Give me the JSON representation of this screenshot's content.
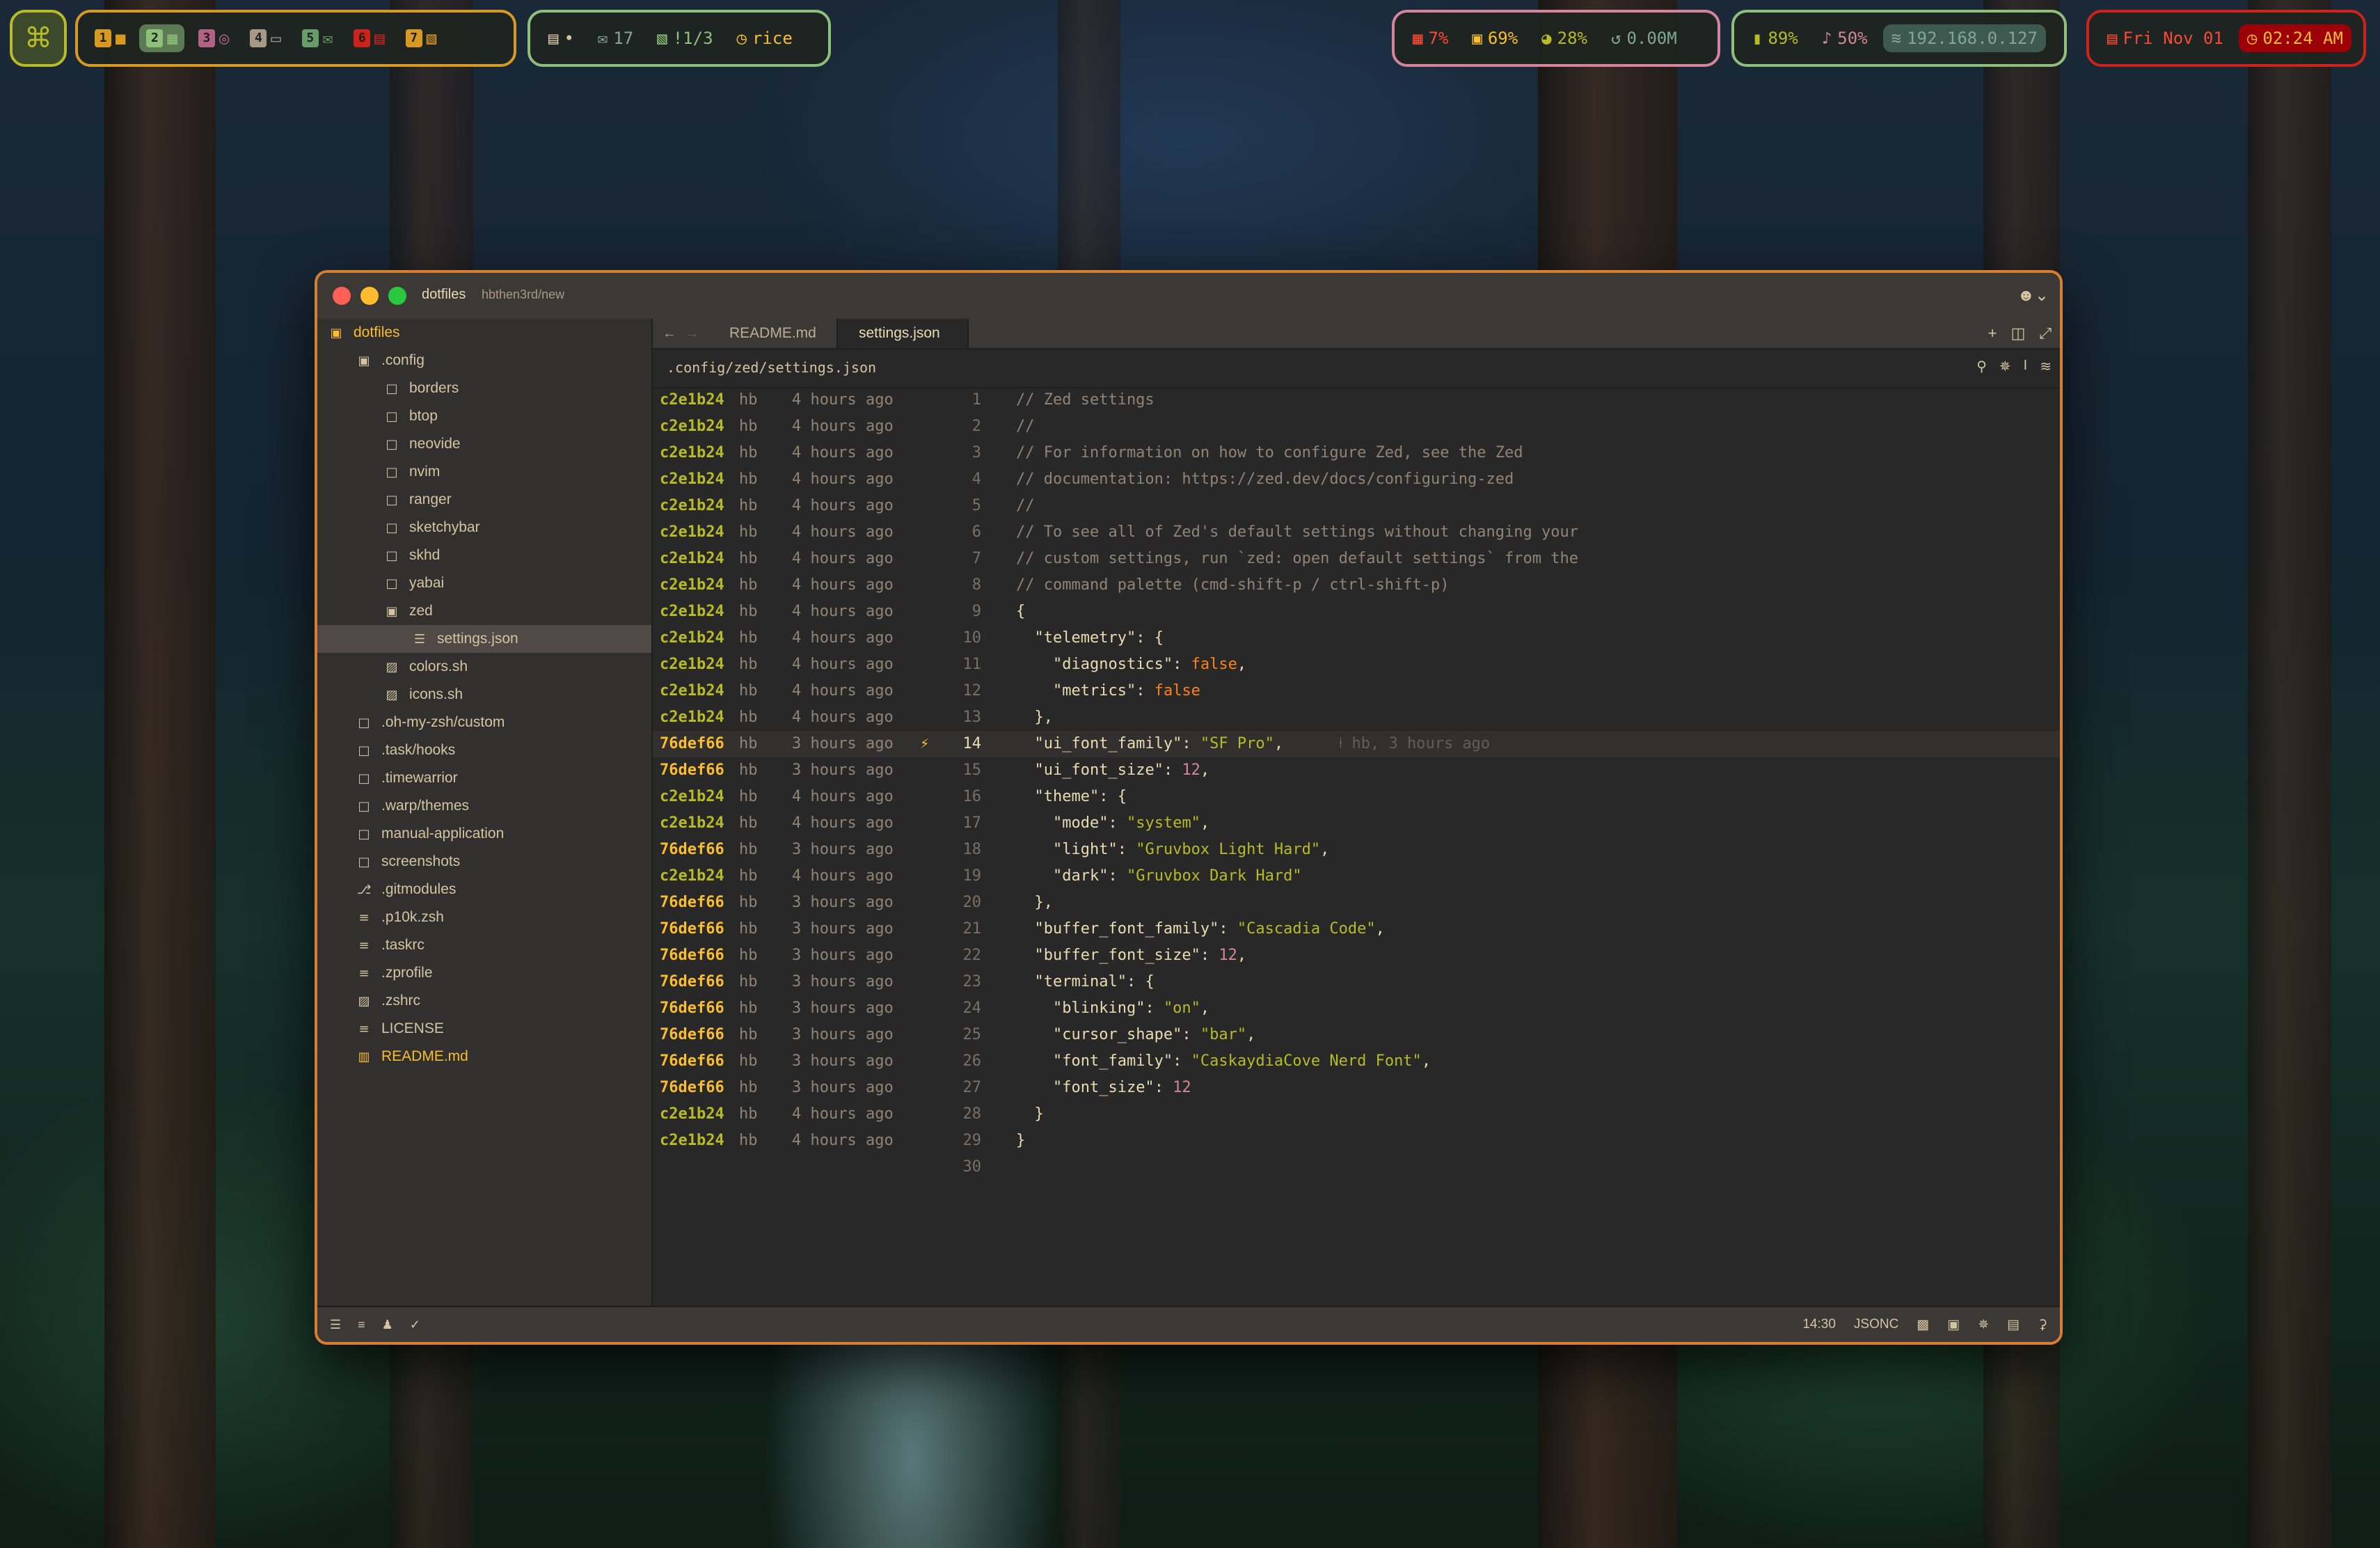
{
  "topbar": {
    "workspaces": [
      {
        "num": "1",
        "icon": "■",
        "color": "#d79921",
        "active": false
      },
      {
        "num": "2",
        "icon": "▦",
        "color": "#8ec07c",
        "active": true
      },
      {
        "num": "3",
        "icon": "◎",
        "color": "#b16286",
        "active": false
      },
      {
        "num": "4",
        "icon": "▭",
        "color": "#a89984",
        "active": false
      },
      {
        "num": "5",
        "icon": "✉",
        "color": "#689d6a",
        "active": false
      },
      {
        "num": "6",
        "icon": "▤",
        "color": "#cc241d",
        "active": false
      },
      {
        "num": "7",
        "icon": "▧",
        "color": "#d79921",
        "active": false
      }
    ],
    "messages_dot": "•",
    "mail_count": "17",
    "tasks": "!1/3",
    "mode": "rice",
    "cpu": "7%",
    "memory": "69%",
    "disk": "28%",
    "network": "0.00M",
    "battery": "89%",
    "volume": "50%",
    "ip": "192.168.0.127",
    "date": "Fri Nov 01",
    "time": "02:24 AM"
  },
  "window": {
    "title": "dotfiles",
    "branch": "hbthen3rd/new"
  },
  "sidebar": {
    "root": "dotfiles",
    "items": [
      {
        "label": ".config",
        "icon": "folder-open-icon",
        "glyph": "▣",
        "depth": 1,
        "selected": false,
        "color": "#d5c4a1"
      },
      {
        "label": "borders",
        "icon": "folder-icon",
        "glyph": "□",
        "depth": 2,
        "selected": false,
        "color": "#d5c4a1"
      },
      {
        "label": "btop",
        "icon": "folder-icon",
        "glyph": "□",
        "depth": 2,
        "selected": false,
        "color": "#d5c4a1"
      },
      {
        "label": "neovide",
        "icon": "folder-icon",
        "glyph": "□",
        "depth": 2,
        "selected": false,
        "color": "#d5c4a1"
      },
      {
        "label": "nvim",
        "icon": "folder-icon",
        "glyph": "□",
        "depth": 2,
        "selected": false,
        "color": "#d5c4a1"
      },
      {
        "label": "ranger",
        "icon": "folder-icon",
        "glyph": "□",
        "depth": 2,
        "selected": false,
        "color": "#d5c4a1"
      },
      {
        "label": "sketchybar",
        "icon": "folder-icon",
        "glyph": "□",
        "depth": 2,
        "selected": false,
        "color": "#d5c4a1"
      },
      {
        "label": "skhd",
        "icon": "folder-icon",
        "glyph": "□",
        "depth": 2,
        "selected": false,
        "color": "#d5c4a1"
      },
      {
        "label": "yabai",
        "icon": "folder-icon",
        "glyph": "□",
        "depth": 2,
        "selected": false,
        "color": "#d5c4a1"
      },
      {
        "label": "zed",
        "icon": "folder-open-icon",
        "glyph": "▣",
        "depth": 2,
        "selected": false,
        "color": "#d5c4a1"
      },
      {
        "label": "settings.json",
        "icon": "json-file-icon",
        "glyph": "☰",
        "depth": 3,
        "selected": true,
        "color": "#d5c4a1"
      },
      {
        "label": "colors.sh",
        "icon": "shell-file-icon",
        "glyph": "▨",
        "depth": 2,
        "selected": false,
        "color": "#d5c4a1"
      },
      {
        "label": "icons.sh",
        "icon": "shell-file-icon",
        "glyph": "▨",
        "depth": 2,
        "selected": false,
        "color": "#d5c4a1"
      },
      {
        "label": ".oh-my-zsh/custom",
        "icon": "folder-icon",
        "glyph": "□",
        "depth": 1,
        "selected": false,
        "color": "#d5c4a1"
      },
      {
        "label": ".task/hooks",
        "icon": "folder-icon",
        "glyph": "□",
        "depth": 1,
        "selected": false,
        "color": "#d5c4a1"
      },
      {
        "label": ".timewarrior",
        "icon": "folder-icon",
        "glyph": "□",
        "depth": 1,
        "selected": false,
        "color": "#d5c4a1"
      },
      {
        "label": ".warp/themes",
        "icon": "folder-icon",
        "glyph": "□",
        "depth": 1,
        "selected": false,
        "color": "#d5c4a1"
      },
      {
        "label": "manual-application",
        "icon": "folder-icon",
        "glyph": "□",
        "depth": 1,
        "selected": false,
        "color": "#d5c4a1"
      },
      {
        "label": "screenshots",
        "icon": "folder-icon",
        "glyph": "□",
        "depth": 1,
        "selected": false,
        "color": "#d5c4a1"
      },
      {
        "label": ".gitmodules",
        "icon": "git-icon",
        "glyph": "⎇",
        "depth": 1,
        "selected": false,
        "color": "#d5c4a1"
      },
      {
        "label": ".p10k.zsh",
        "icon": "text-file-icon",
        "glyph": "≡",
        "depth": 1,
        "selected": false,
        "color": "#d5c4a1"
      },
      {
        "label": ".taskrc",
        "icon": "text-file-icon",
        "glyph": "≡",
        "depth": 1,
        "selected": false,
        "color": "#d5c4a1"
      },
      {
        "label": ".zprofile",
        "icon": "text-file-icon",
        "glyph": "≡",
        "depth": 1,
        "selected": false,
        "color": "#d5c4a1"
      },
      {
        "label": ".zshrc",
        "icon": "shell-file-icon",
        "glyph": "▨",
        "depth": 1,
        "selected": false,
        "color": "#d5c4a1"
      },
      {
        "label": "LICENSE",
        "icon": "text-file-icon",
        "glyph": "≡",
        "depth": 1,
        "selected": false,
        "color": "#d5c4a1"
      },
      {
        "label": "README.md",
        "icon": "book-icon",
        "glyph": "▥",
        "depth": 1,
        "selected": false,
        "color": "#fabd2f"
      }
    ]
  },
  "tabs": [
    {
      "label": "README.md",
      "active": false
    },
    {
      "label": "settings.json",
      "active": true
    }
  ],
  "editor": {
    "path": ".config/zed/settings.json",
    "inline_blame": "hb, 3 hours ago",
    "current_line": 14,
    "lines": [
      {
        "hash": "c2e1b24",
        "author": "hb",
        "time": "4 hours ago",
        "n": "1",
        "html": "<span class='c'>// Zed settings</span>"
      },
      {
        "hash": "c2e1b24",
        "author": "hb",
        "time": "4 hours ago",
        "n": "2",
        "html": "<span class='c'>//</span>"
      },
      {
        "hash": "c2e1b24",
        "author": "hb",
        "time": "4 hours ago",
        "n": "3",
        "html": "<span class='c'>// For information on how to configure Zed, see the Zed</span>"
      },
      {
        "hash": "c2e1b24",
        "author": "hb",
        "time": "4 hours ago",
        "n": "4",
        "html": "<span class='c'>// documentation: https://zed.dev/docs/configuring-zed</span>"
      },
      {
        "hash": "c2e1b24",
        "author": "hb",
        "time": "4 hours ago",
        "n": "5",
        "html": "<span class='c'>//</span>"
      },
      {
        "hash": "c2e1b24",
        "author": "hb",
        "time": "4 hours ago",
        "n": "6",
        "html": "<span class='c'>// To see all of Zed's default settings without changing your</span>"
      },
      {
        "hash": "c2e1b24",
        "author": "hb",
        "time": "4 hours ago",
        "n": "7",
        "html": "<span class='c'>// custom settings, run `zed: open default settings` from the</span>"
      },
      {
        "hash": "c2e1b24",
        "author": "hb",
        "time": "4 hours ago",
        "n": "8",
        "html": "<span class='c'>// command palette (cmd-shift-p / ctrl-shift-p)</span>"
      },
      {
        "hash": "c2e1b24",
        "author": "hb",
        "time": "4 hours ago",
        "n": "9",
        "html": "<span class='p'>{</span>"
      },
      {
        "hash": "c2e1b24",
        "author": "hb",
        "time": "4 hours ago",
        "n": "10",
        "html": "  <span class='k'>\"telemetry\"</span>: {"
      },
      {
        "hash": "c2e1b24",
        "author": "hb",
        "time": "4 hours ago",
        "n": "11",
        "html": "    <span class='k'>\"diagnostics\"</span>: <span class='b'>false</span>,"
      },
      {
        "hash": "c2e1b24",
        "author": "hb",
        "time": "4 hours ago",
        "n": "12",
        "html": "    <span class='k'>\"metrics\"</span>: <span class='b'>false</span>"
      },
      {
        "hash": "c2e1b24",
        "author": "hb",
        "time": "4 hours ago",
        "n": "13",
        "html": "  },"
      },
      {
        "hash": "76def66",
        "author": "hb",
        "time": "3 hours ago",
        "n": "14",
        "html": "  <span class='k'>\"ui_font_family\"</span>: <span class='s'>\"SF Pro\"</span>,"
      },
      {
        "hash": "76def66",
        "author": "hb",
        "time": "3 hours ago",
        "n": "15",
        "html": "  <span class='k'>\"ui_font_size\"</span>: <span class='num'>12</span>,"
      },
      {
        "hash": "c2e1b24",
        "author": "hb",
        "time": "4 hours ago",
        "n": "16",
        "html": "  <span class='k'>\"theme\"</span>: {"
      },
      {
        "hash": "c2e1b24",
        "author": "hb",
        "time": "4 hours ago",
        "n": "17",
        "html": "    <span class='k'>\"mode\"</span>: <span class='s'>\"system\"</span>,"
      },
      {
        "hash": "76def66",
        "author": "hb",
        "time": "3 hours ago",
        "n": "18",
        "html": "    <span class='k'>\"light\"</span>: <span class='s'>\"Gruvbox Light Hard\"</span>,"
      },
      {
        "hash": "c2e1b24",
        "author": "hb",
        "time": "4 hours ago",
        "n": "19",
        "html": "    <span class='k'>\"dark\"</span>: <span class='s'>\"Gruvbox Dark Hard\"</span>"
      },
      {
        "hash": "76def66",
        "author": "hb",
        "time": "3 hours ago",
        "n": "20",
        "html": "  },"
      },
      {
        "hash": "76def66",
        "author": "hb",
        "time": "3 hours ago",
        "n": "21",
        "html": "  <span class='k'>\"buffer_font_family\"</span>: <span class='s'>\"Cascadia Code\"</span>,"
      },
      {
        "hash": "76def66",
        "author": "hb",
        "time": "3 hours ago",
        "n": "22",
        "html": "  <span class='k'>\"buffer_font_size\"</span>: <span class='num'>12</span>,"
      },
      {
        "hash": "76def66",
        "author": "hb",
        "time": "3 hours ago",
        "n": "23",
        "html": "  <span class='k'>\"terminal\"</span>: {"
      },
      {
        "hash": "76def66",
        "author": "hb",
        "time": "3 hours ago",
        "n": "24",
        "html": "    <span class='k'>\"blinking\"</span>: <span class='s'>\"on\"</span>,"
      },
      {
        "hash": "76def66",
        "author": "hb",
        "time": "3 hours ago",
        "n": "25",
        "html": "    <span class='k'>\"cursor_shape\"</span>: <span class='s'>\"bar\"</span>,"
      },
      {
        "hash": "76def66",
        "author": "hb",
        "time": "3 hours ago",
        "n": "26",
        "html": "    <span class='k'>\"font_family\"</span>: <span class='s'>\"CaskaydiaCove Nerd Font\"</span>,"
      },
      {
        "hash": "76def66",
        "author": "hb",
        "time": "3 hours ago",
        "n": "27",
        "html": "    <span class='k'>\"font_size\"</span>: <span class='num'>12</span>"
      },
      {
        "hash": "c2e1b24",
        "author": "hb",
        "time": "4 hours ago",
        "n": "28",
        "html": "  }"
      },
      {
        "hash": "c2e1b24",
        "author": "hb",
        "time": "4 hours ago",
        "n": "29",
        "html": "}"
      },
      {
        "hash": "",
        "author": "",
        "time": "",
        "n": "30",
        "html": ""
      }
    ]
  },
  "statusbar": {
    "cursor": "14:30",
    "language": "JSONC"
  },
  "colors": {
    "accent": "#d87e30",
    "green": "#b8bb26",
    "yellow": "#fabd2f",
    "red": "#cc241d",
    "bg": "#282828"
  }
}
